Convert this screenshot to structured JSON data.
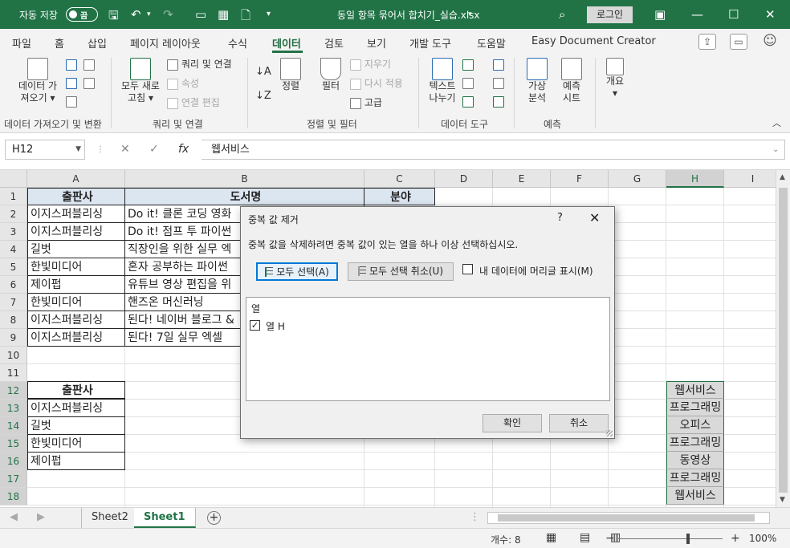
{
  "titlebar": {
    "autosave_label": "자동 저장",
    "autosave_state": "끔",
    "filename": "동일 항목 묶어서 합치기_실습.xlsx",
    "login": "로그인"
  },
  "ribbon_tabs": [
    "파일",
    "홈",
    "삽입",
    "페이지 레이아웃",
    "수식",
    "데이터",
    "검토",
    "보기",
    "개발 도구",
    "도움말",
    "Easy Document Creator"
  ],
  "active_tab": "데이터",
  "ribbon": {
    "get_data": "데이터 가\n져오기",
    "refresh_all": "모두 새로\n고침",
    "queries": "쿼리 및 연결",
    "properties": "속성",
    "edit_links": "연결 편집",
    "sort": "정렬",
    "filter": "필터",
    "clear": "지우기",
    "reapply": "다시 적용",
    "advanced": "고급",
    "text_to_columns": "텍스트\n나누기",
    "what_if": "가상\n분석",
    "forecast": "예측\n시트",
    "outline": "개요",
    "groups": {
      "get_transform": "데이터 가져오기 및 변환",
      "queries_connections": "쿼리 및 연결",
      "sort_filter": "정렬 및 필터",
      "data_tools": "데이터 도구",
      "forecast": "예측"
    }
  },
  "formula_bar": {
    "name_box": "H12",
    "cancel": "✕",
    "enter": "✓",
    "fx": "fx",
    "formula": "웹서비스"
  },
  "grid": {
    "columns": [
      "A",
      "B",
      "C",
      "D",
      "E",
      "F",
      "G",
      "H",
      "I"
    ],
    "rows": [
      "1",
      "2",
      "3",
      "4",
      "5",
      "6",
      "7",
      "8",
      "9",
      "10",
      "11",
      "12",
      "13",
      "14",
      "15",
      "16",
      "17",
      "18"
    ],
    "header_row": [
      "출판사",
      "도서명",
      "분야"
    ],
    "col_a": [
      "이지스퍼블리싱",
      "이지스퍼블리싱",
      "길벗",
      "한빛미디어",
      "제이펍",
      "한빛미디어",
      "이지스퍼블리싱",
      "이지스퍼블리싱"
    ],
    "col_b": [
      "Do it! 클론 코딩 영화",
      "Do it! 점프 투 파이썬",
      "직장인을 위한 실무 엑",
      "혼자 공부하는 파이썬",
      "유튜브 영상 편집을 위",
      "핸즈온 머신러닝",
      "된다! 네이버 블로그 &",
      "된다! 7일 실무 엑셀"
    ],
    "table2_header": "출판사",
    "table2_values": [
      "이지스퍼블리싱",
      "길벗",
      "한빛미디어",
      "제이펍"
    ],
    "col_h": [
      "웹서비스",
      "프로그래밍",
      "오피스",
      "프로그래밍",
      "동영상",
      "프로그래밍",
      "웹서비스"
    ]
  },
  "sheets": [
    "Sheet2",
    "Sheet1"
  ],
  "active_sheet": "Sheet1",
  "status": {
    "count": "개수: 8",
    "zoom": "100%"
  },
  "dialog": {
    "title": "중복 값 제거",
    "help": "?",
    "close": "✕",
    "description": "중복 값을 삭제하려면 중복 값이 있는 열을 하나 이상 선택하십시오.",
    "select_all": "모두 선택(A)",
    "unselect_all": "모두 선택 취소(U)",
    "headers_checkbox": "내 데이터에 머리글 표시(M)",
    "list_header": "열",
    "columns": [
      "열 H"
    ],
    "ok": "확인",
    "cancel": "취소"
  }
}
